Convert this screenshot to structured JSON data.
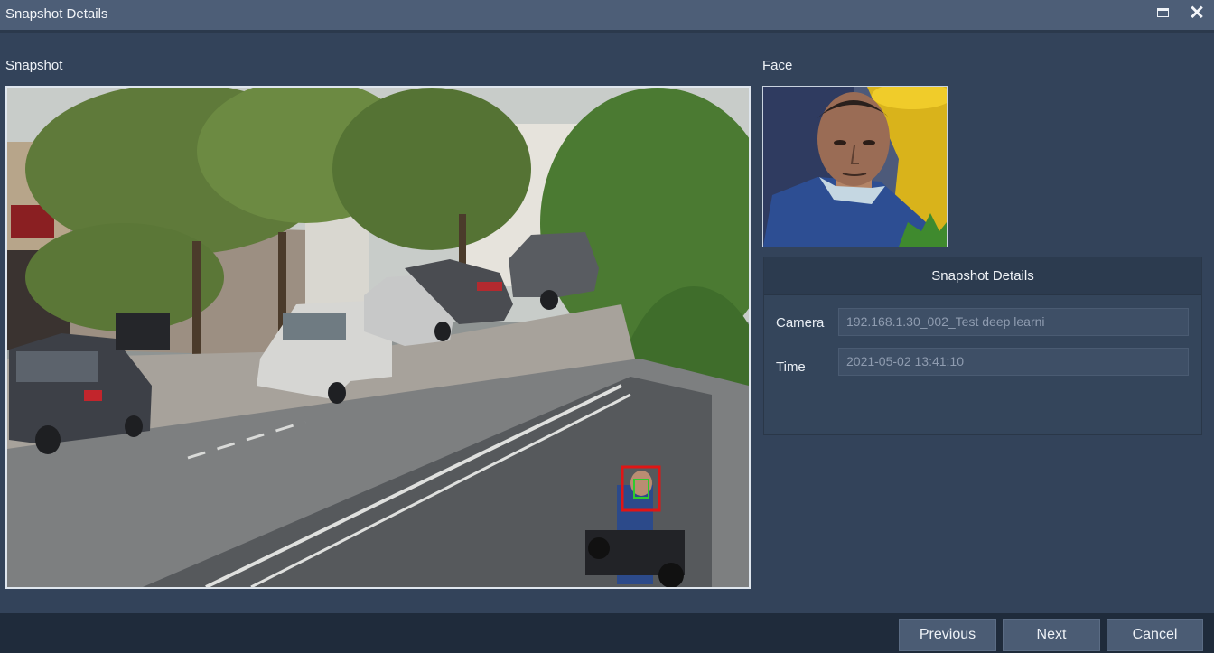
{
  "window": {
    "title": "Snapshot Details",
    "maximize_icon": "maximize-icon",
    "close_glyph": "✕"
  },
  "snapshot": {
    "label": "Snapshot"
  },
  "face": {
    "label": "Face"
  },
  "details": {
    "header": "Snapshot Details",
    "camera_label": "Camera",
    "camera_value": "192.168.1.30_002_Test deep learni",
    "time_label": "Time",
    "time_value": "2021-05-02 13:41:10"
  },
  "buttons": {
    "previous": "Previous",
    "next": "Next",
    "cancel": "Cancel"
  },
  "colors": {
    "background": "#33435a",
    "titlebar": "#4d5e77",
    "footer": "#1f2b3b",
    "button": "#4b5c74",
    "detection_box": "#e01515",
    "face_box": "#2ecc2e"
  }
}
